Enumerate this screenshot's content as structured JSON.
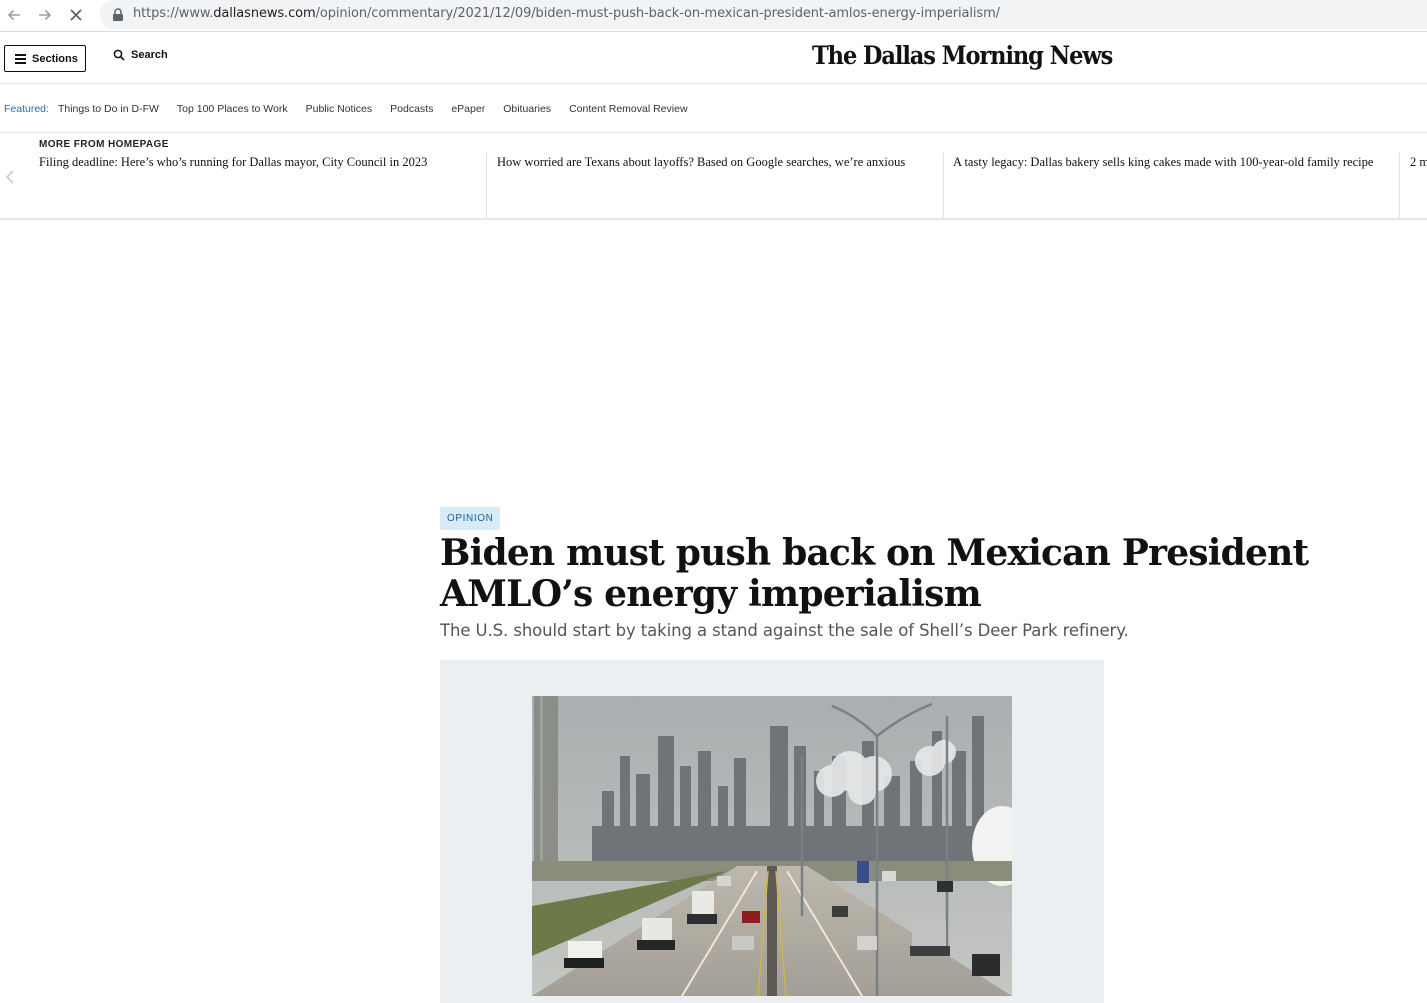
{
  "browser": {
    "url_prefix": "https://www.",
    "url_host": "dallasnews.com",
    "url_path": "/opinion/commentary/2021/12/09/biden-must-push-back-on-mexican-president-amlos-energy-imperialism/"
  },
  "header": {
    "sections_label": "Sections",
    "search_label": "Search",
    "masthead": "The Dallas Morning News"
  },
  "featured": {
    "label": "Featured:",
    "links": [
      "Things to Do in D-FW",
      "Top 100 Places to Work",
      "Public Notices",
      "Podcasts",
      "ePaper",
      "Obituaries",
      "Content Removal Review"
    ]
  },
  "more_from_homepage": {
    "label": "MORE FROM HOMEPAGE",
    "items": [
      "Filing deadline: Here’s who’s running for Dallas mayor, City Council in 2023",
      "How worried are Texans about layoffs? Based on Google searches, we’re anxious",
      "A tasty legacy: Dallas bakery sells king cakes made with 100-year-old family recipe",
      "2 m"
    ]
  },
  "article": {
    "tag": "OPINION",
    "headline": "Biden must push back on Mexican President AMLO’s energy imperialism",
    "dek": "The U.S. should start by taking a stand against the sale of Shell’s Deer Park refinery."
  },
  "colors": {
    "tag_bg": "#d7ecf8",
    "tag_text": "#1e5f86",
    "featured_label": "#2a6f9e",
    "photo_bg": "#eceff1"
  }
}
